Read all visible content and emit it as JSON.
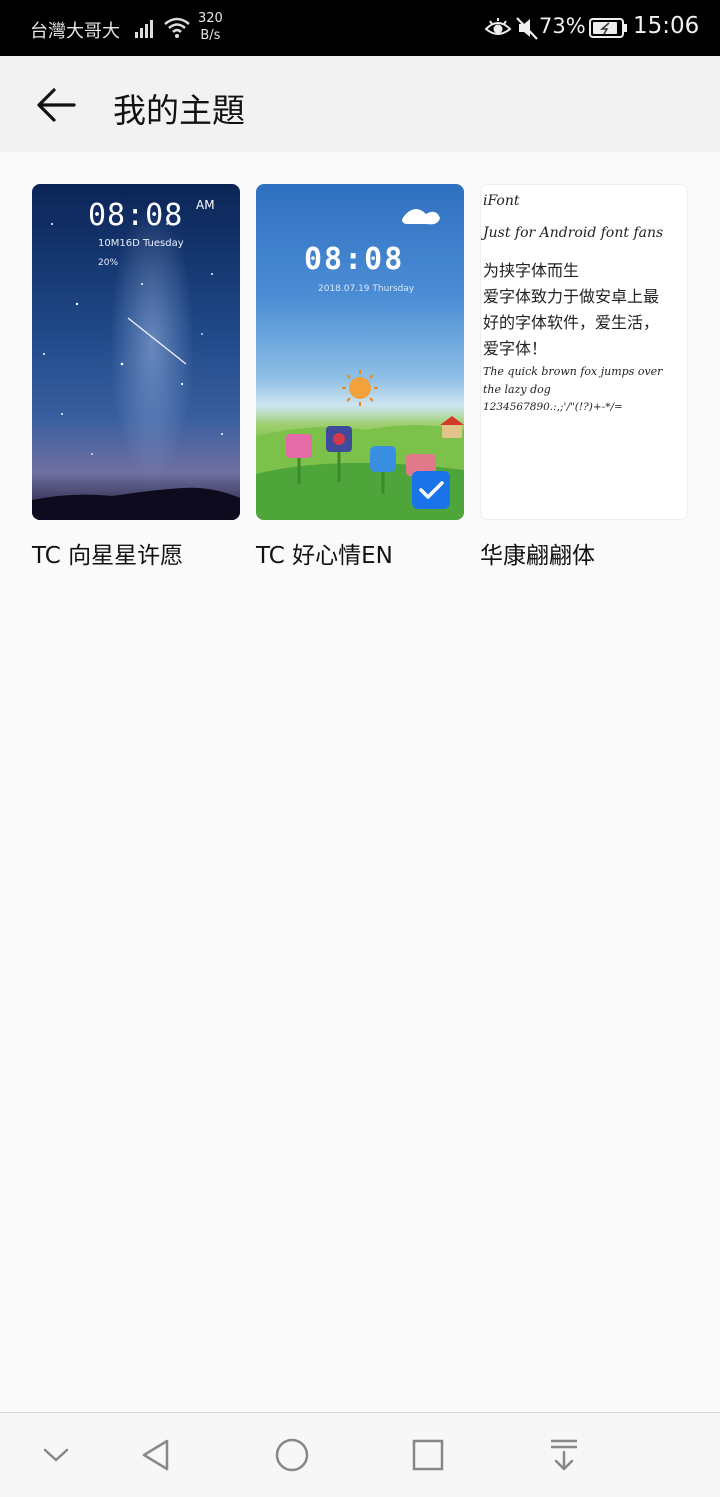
{
  "status_bar": {
    "carrier": "台灣大哥大",
    "net_speed_value": "320",
    "net_speed_unit": "B/s",
    "battery_percent": "73%",
    "time": "15:06",
    "icons": [
      "signal-icon",
      "wifi-icon",
      "eye-comfort-icon",
      "mute-icon",
      "battery-icon"
    ]
  },
  "header": {
    "back_icon": "arrow-left-icon",
    "title": "我的主題"
  },
  "themes": [
    {
      "label": "TC 向星星许愿",
      "preview": {
        "time": "08:08",
        "ampm": "AM",
        "date": "10M16D Tuesday",
        "battery": "20%"
      },
      "selected": false
    },
    {
      "label": "TC 好心情EN",
      "preview": {
        "time": "08:08",
        "date": "2018.07.19 Thursday"
      },
      "selected": true
    },
    {
      "label": "华康翩翩体",
      "preview": {
        "lines": [
          "iFont",
          "Just for Android font fans",
          "为挟字体而生",
          "爱字体致力于做安卓上最",
          "好的字体软件，爱生活，",
          "爱字体！",
          "The quick brown fox jumps over",
          "the lazy dog",
          "1234567890.:,;'/\"(!?)+-*/="
        ]
      },
      "selected": false
    }
  ],
  "nav_bar": {
    "icons": [
      "chevron-down-icon",
      "back-triangle-icon",
      "home-circle-icon",
      "recents-square-icon",
      "notification-pulldown-icon"
    ]
  },
  "colors": {
    "status_bar_bg": "#000000",
    "header_bg": "#f2f2f2",
    "page_bg": "#fafafa",
    "selected_badge": "#1a73e8"
  }
}
